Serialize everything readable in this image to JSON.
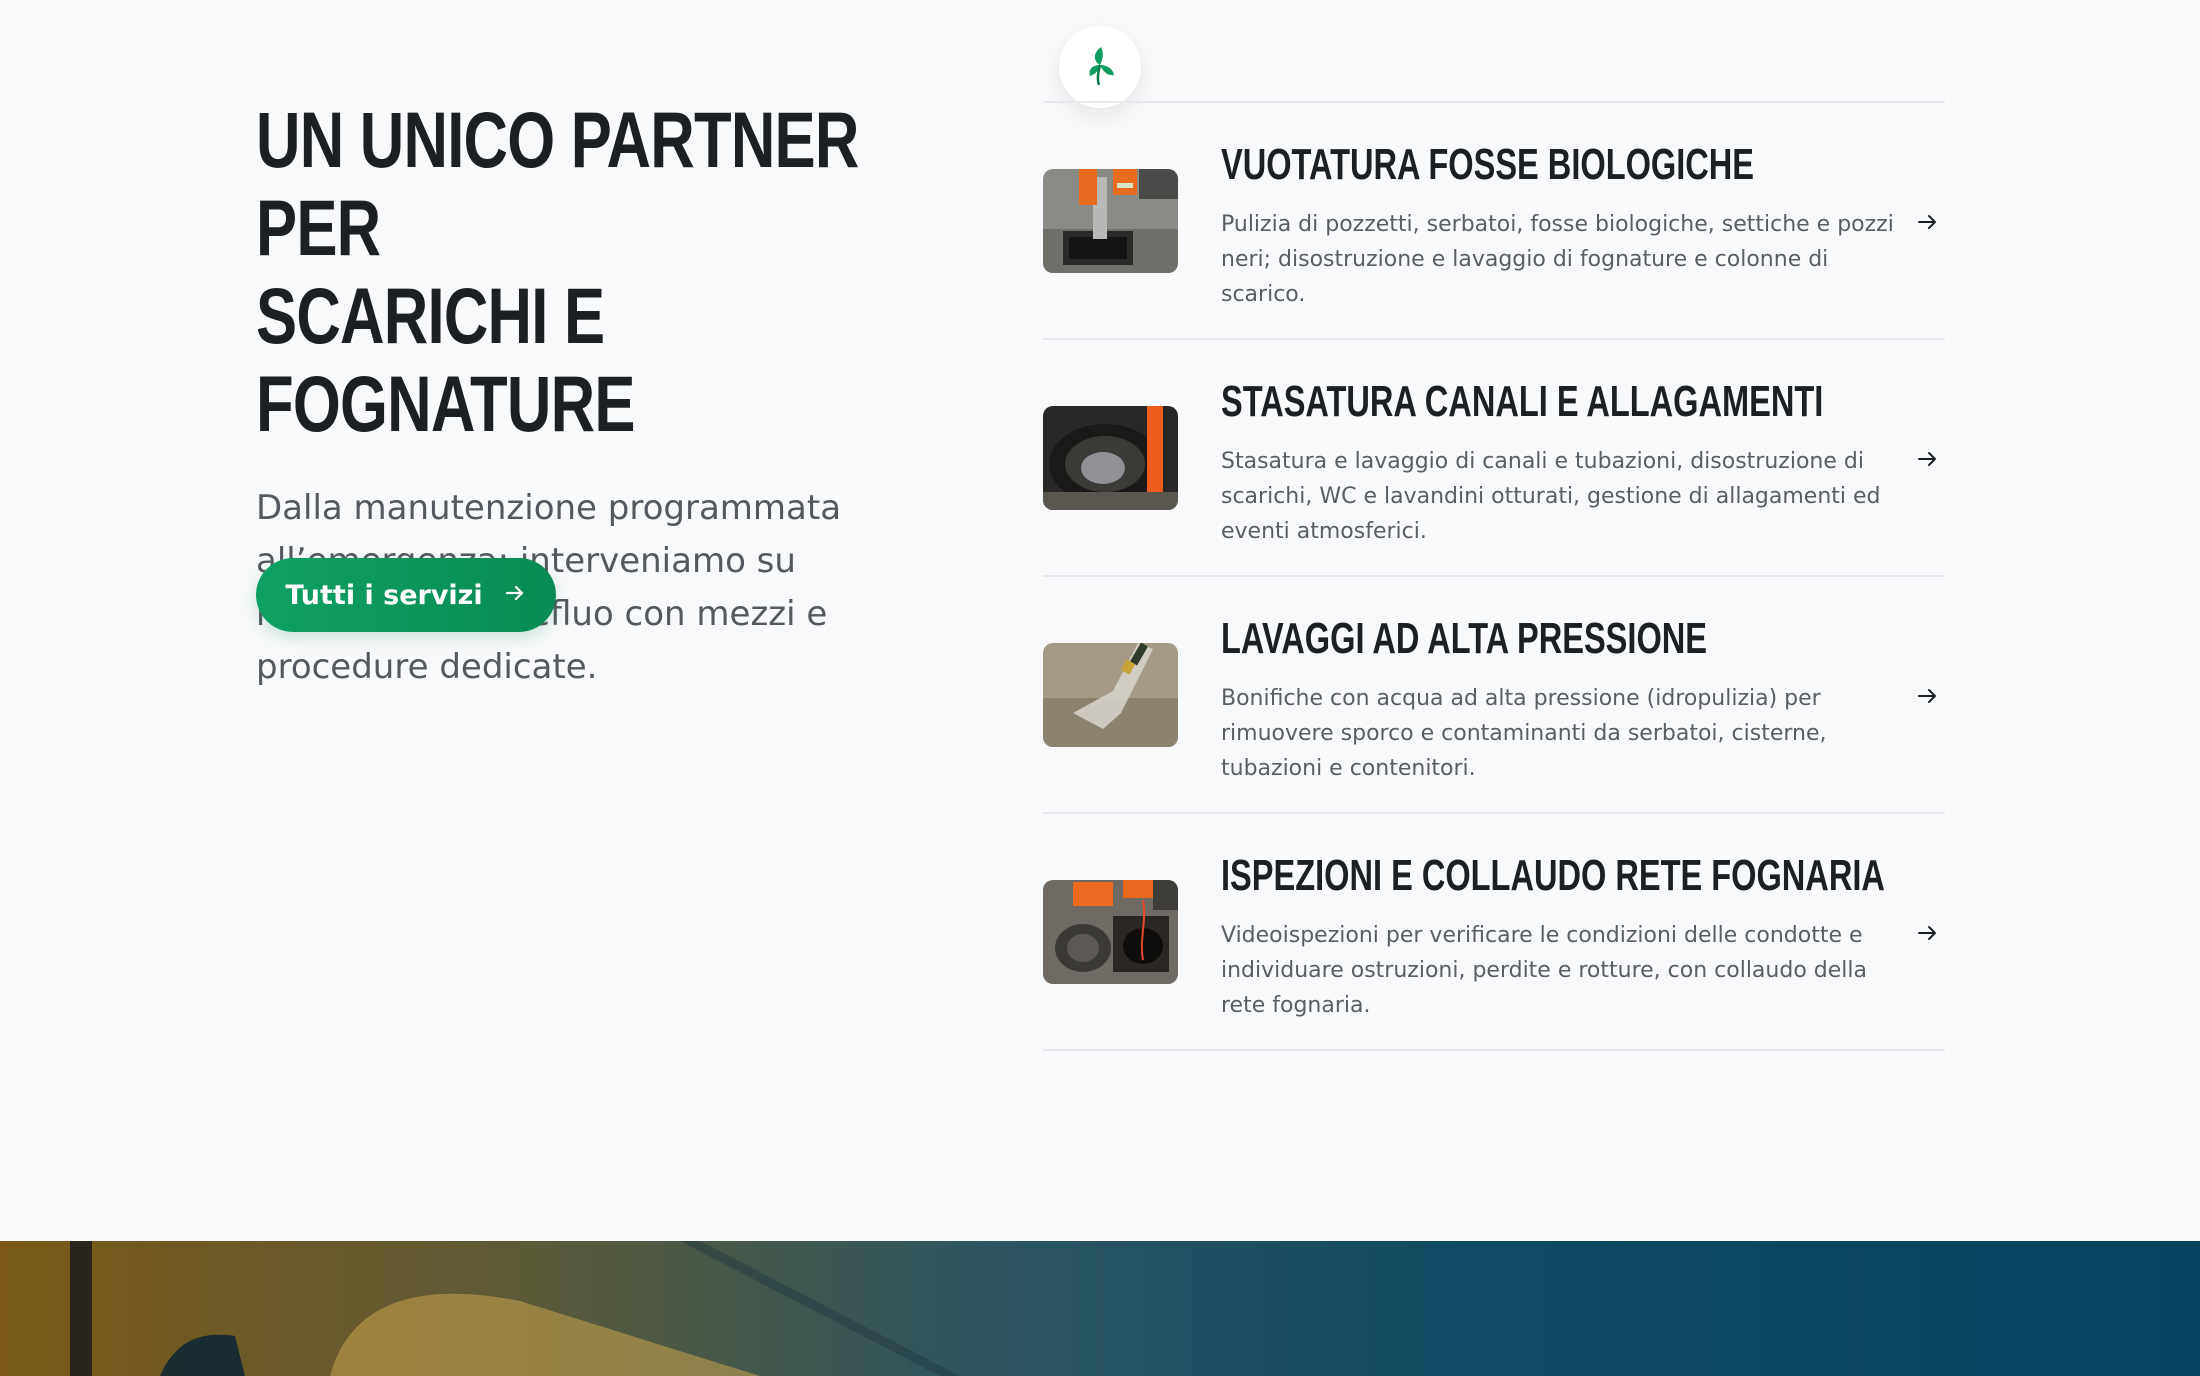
{
  "intro": {
    "headline_line1": "UN UNICO PARTNER PER",
    "headline_line2": "SCARICHI E FOGNATURE",
    "lead": "Dalla manutenzione programmata all’emergenza: interveniamo su reti, impianti e refluo con mezzi e procedure dedicate.",
    "cta_label": "Tutti i servizi",
    "cta_icon": "arrow-right-icon"
  },
  "brand": {
    "logo_icon": "leaf-logo-icon",
    "accent": "#0f9d62"
  },
  "services": [
    {
      "title": "VUOTATURA FOSSE BIOLOGICHE",
      "description": "Pulizia di pozzetti, serbatoi, fosse biologiche, settiche e pozzi neri; disostruzione e lavaggio di fognature e colonne di scarico.",
      "image": "worker-with-hose-at-manhole-photo"
    },
    {
      "title": "STASATURA CANALI E ALLAGAMENTI",
      "description": "Stasatura e lavaggio di canali e tubazioni, disostruzione di scarichi, WC e lavandini otturati, gestione di allagamenti ed eventi atmosferici.",
      "image": "pipe-in-drain-photo"
    },
    {
      "title": "LAVAGGI AD ALTA PRESSIONE",
      "description": "Bonifiche con acqua ad alta pressione (idropulizia) per rimuovere sporco e contaminanti da serbatoi, cisterne, tubazioni e contenitori.",
      "image": "pressure-washer-photo"
    },
    {
      "title": "ISPEZIONI E COLLAUDO RETE FOGNARIA",
      "description": "Videoispezioni per verificare le condizioni delle condotte e individuare ostruzioni, perdite e rotture, con collaudo della rete fognaria.",
      "image": "sewer-camera-inspection-photo"
    }
  ]
}
